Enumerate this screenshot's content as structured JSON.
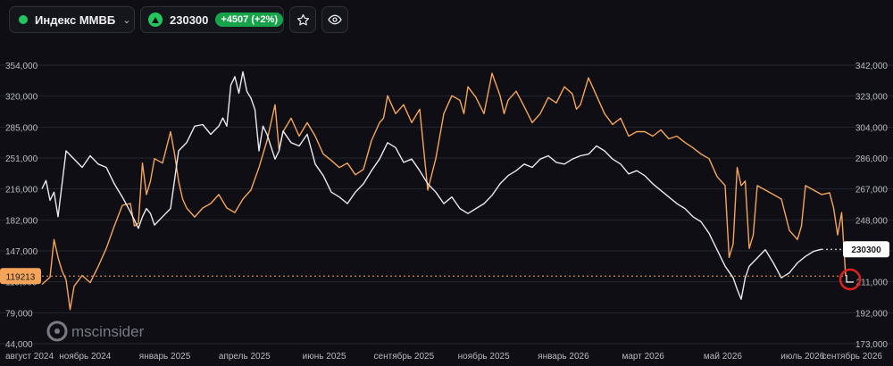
{
  "header": {
    "ticker_name": "Индекс ММВБ",
    "price": "230300",
    "change": "+4507 (+2%)",
    "icons": [
      "dropdown-chevron",
      "up-triangle",
      "star-icon",
      "eye-icon"
    ]
  },
  "watermark": "mscinsider",
  "chart_data": {
    "type": "line",
    "left_axis": {
      "ticks": [
        "354,000",
        "320,000",
        "285,000",
        "251,000",
        "216,000",
        "182,000",
        "147,000",
        "113,000",
        "79,000",
        "44,000"
      ],
      "range": [
        44000,
        354000
      ],
      "current_badge": "119213"
    },
    "right_axis": {
      "ticks": [
        "342,000",
        "323,000",
        "304,000",
        "286,000",
        "267,000",
        "248,000",
        "230,000",
        "211,000",
        "192,000",
        "173,000"
      ],
      "range": [
        173000,
        342000
      ],
      "current_badge": "230300"
    },
    "x_labels": [
      "август 2024",
      "ноябрь 2024",
      "январь 2025",
      "апрель 2025",
      "июнь 2025",
      "сентябрь 2025",
      "ноябрь 2025",
      "январь 2026",
      "март 2026",
      "май 2026",
      "июль 2026",
      "сентябрь 2026"
    ],
    "grid": "horizontal",
    "colors": {
      "orange": "#f5a55a",
      "white": "#e8e8ee",
      "grid": "#262630",
      "badge_orange": "#f5a55a",
      "badge_white": "#ffffff",
      "marker": "#e02020"
    },
    "series": [
      {
        "axis": "left",
        "color": "#f5a55a",
        "points": [
          [
            0,
            110000
          ],
          [
            0.01,
            118000
          ],
          [
            0.015,
            160000
          ],
          [
            0.02,
            140000
          ],
          [
            0.025,
            125000
          ],
          [
            0.03,
            115000
          ],
          [
            0.035,
            82000
          ],
          [
            0.04,
            108000
          ],
          [
            0.05,
            120000
          ],
          [
            0.06,
            112000
          ],
          [
            0.07,
            130000
          ],
          [
            0.08,
            150000
          ],
          [
            0.09,
            175000
          ],
          [
            0.1,
            198000
          ],
          [
            0.11,
            200000
          ],
          [
            0.115,
            175000
          ],
          [
            0.12,
            178000
          ],
          [
            0.125,
            245000
          ],
          [
            0.13,
            210000
          ],
          [
            0.135,
            225000
          ],
          [
            0.14,
            250000
          ],
          [
            0.15,
            245000
          ],
          [
            0.16,
            280000
          ],
          [
            0.165,
            255000
          ],
          [
            0.17,
            225000
          ],
          [
            0.175,
            205000
          ],
          [
            0.18,
            195000
          ],
          [
            0.19,
            185000
          ],
          [
            0.2,
            195000
          ],
          [
            0.21,
            200000
          ],
          [
            0.22,
            210000
          ],
          [
            0.23,
            195000
          ],
          [
            0.24,
            190000
          ],
          [
            0.25,
            205000
          ],
          [
            0.255,
            210000
          ],
          [
            0.26,
            215000
          ],
          [
            0.27,
            240000
          ],
          [
            0.28,
            270000
          ],
          [
            0.29,
            310000
          ],
          [
            0.295,
            260000
          ],
          [
            0.3,
            280000
          ],
          [
            0.31,
            295000
          ],
          [
            0.32,
            275000
          ],
          [
            0.33,
            290000
          ],
          [
            0.34,
            275000
          ],
          [
            0.35,
            255000
          ],
          [
            0.36,
            248000
          ],
          [
            0.37,
            240000
          ],
          [
            0.38,
            245000
          ],
          [
            0.39,
            232000
          ],
          [
            0.4,
            238000
          ],
          [
            0.41,
            270000
          ],
          [
            0.42,
            290000
          ],
          [
            0.425,
            295000
          ],
          [
            0.43,
            320000
          ],
          [
            0.44,
            300000
          ],
          [
            0.45,
            310000
          ],
          [
            0.46,
            290000
          ],
          [
            0.47,
            305000
          ],
          [
            0.48,
            215000
          ],
          [
            0.49,
            250000
          ],
          [
            0.5,
            300000
          ],
          [
            0.51,
            320000
          ],
          [
            0.52,
            315000
          ],
          [
            0.525,
            300000
          ],
          [
            0.53,
            330000
          ],
          [
            0.54,
            318000
          ],
          [
            0.55,
            300000
          ],
          [
            0.56,
            345000
          ],
          [
            0.57,
            320000
          ],
          [
            0.575,
            300000
          ],
          [
            0.58,
            315000
          ],
          [
            0.59,
            325000
          ],
          [
            0.6,
            308000
          ],
          [
            0.61,
            290000
          ],
          [
            0.62,
            300000
          ],
          [
            0.63,
            318000
          ],
          [
            0.64,
            312000
          ],
          [
            0.65,
            330000
          ],
          [
            0.66,
            322000
          ],
          [
            0.665,
            305000
          ],
          [
            0.67,
            310000
          ],
          [
            0.68,
            340000
          ],
          [
            0.69,
            320000
          ],
          [
            0.7,
            300000
          ],
          [
            0.71,
            288000
          ],
          [
            0.72,
            295000
          ],
          [
            0.73,
            275000
          ],
          [
            0.74,
            280000
          ],
          [
            0.75,
            280000
          ],
          [
            0.76,
            275000
          ],
          [
            0.77,
            282000
          ],
          [
            0.78,
            272000
          ],
          [
            0.79,
            275000
          ],
          [
            0.8,
            268000
          ],
          [
            0.81,
            262000
          ],
          [
            0.82,
            255000
          ],
          [
            0.83,
            250000
          ],
          [
            0.84,
            230000
          ],
          [
            0.85,
            220000
          ],
          [
            0.855,
            140000
          ],
          [
            0.86,
            155000
          ],
          [
            0.865,
            240000
          ],
          [
            0.87,
            220000
          ],
          [
            0.875,
            225000
          ],
          [
            0.88,
            150000
          ],
          [
            0.885,
            165000
          ],
          [
            0.89,
            220000
          ],
          [
            0.9,
            215000
          ],
          [
            0.91,
            210000
          ],
          [
            0.92,
            205000
          ],
          [
            0.93,
            170000
          ],
          [
            0.935,
            165000
          ],
          [
            0.94,
            160000
          ],
          [
            0.945,
            175000
          ],
          [
            0.95,
            220000
          ],
          [
            0.96,
            215000
          ],
          [
            0.97,
            210000
          ],
          [
            0.98,
            212000
          ],
          [
            0.985,
            195000
          ],
          [
            0.99,
            165000
          ],
          [
            0.995,
            190000
          ],
          [
            1.0,
            119213
          ]
        ]
      },
      {
        "axis": "right",
        "color": "#e8e8ee",
        "points": [
          [
            0,
            267000
          ],
          [
            0.005,
            272000
          ],
          [
            0.01,
            260000
          ],
          [
            0.015,
            265000
          ],
          [
            0.02,
            250000
          ],
          [
            0.03,
            290000
          ],
          [
            0.04,
            285000
          ],
          [
            0.05,
            280000
          ],
          [
            0.06,
            287000
          ],
          [
            0.07,
            282000
          ],
          [
            0.08,
            280000
          ],
          [
            0.09,
            270000
          ],
          [
            0.1,
            262000
          ],
          [
            0.11,
            253000
          ],
          [
            0.12,
            243000
          ],
          [
            0.125,
            250000
          ],
          [
            0.13,
            255000
          ],
          [
            0.135,
            252000
          ],
          [
            0.14,
            245000
          ],
          [
            0.15,
            250000
          ],
          [
            0.16,
            255000
          ],
          [
            0.17,
            290000
          ],
          [
            0.18,
            295000
          ],
          [
            0.19,
            305000
          ],
          [
            0.2,
            306000
          ],
          [
            0.21,
            300000
          ],
          [
            0.22,
            305000
          ],
          [
            0.225,
            310000
          ],
          [
            0.23,
            305000
          ],
          [
            0.235,
            330000
          ],
          [
            0.24,
            335000
          ],
          [
            0.245,
            325000
          ],
          [
            0.25,
            338000
          ],
          [
            0.255,
            326000
          ],
          [
            0.26,
            322000
          ],
          [
            0.265,
            315000
          ],
          [
            0.27,
            290000
          ],
          [
            0.275,
            305000
          ],
          [
            0.28,
            300000
          ],
          [
            0.29,
            285000
          ],
          [
            0.295,
            290000
          ],
          [
            0.3,
            302000
          ],
          [
            0.31,
            295000
          ],
          [
            0.32,
            293000
          ],
          [
            0.33,
            300000
          ],
          [
            0.34,
            282000
          ],
          [
            0.35,
            275000
          ],
          [
            0.36,
            265000
          ],
          [
            0.37,
            262000
          ],
          [
            0.38,
            258000
          ],
          [
            0.39,
            265000
          ],
          [
            0.4,
            270000
          ],
          [
            0.41,
            278000
          ],
          [
            0.42,
            285000
          ],
          [
            0.43,
            295000
          ],
          [
            0.44,
            292000
          ],
          [
            0.45,
            283000
          ],
          [
            0.46,
            285000
          ],
          [
            0.47,
            278000
          ],
          [
            0.48,
            270000
          ],
          [
            0.49,
            265000
          ],
          [
            0.5,
            258000
          ],
          [
            0.51,
            262000
          ],
          [
            0.52,
            255000
          ],
          [
            0.53,
            252000
          ],
          [
            0.54,
            255000
          ],
          [
            0.55,
            258000
          ],
          [
            0.56,
            263000
          ],
          [
            0.57,
            270000
          ],
          [
            0.58,
            275000
          ],
          [
            0.59,
            278000
          ],
          [
            0.6,
            282000
          ],
          [
            0.61,
            280000
          ],
          [
            0.62,
            285000
          ],
          [
            0.63,
            287000
          ],
          [
            0.64,
            283000
          ],
          [
            0.65,
            282000
          ],
          [
            0.66,
            285000
          ],
          [
            0.67,
            287000
          ],
          [
            0.68,
            288000
          ],
          [
            0.69,
            293000
          ],
          [
            0.7,
            290000
          ],
          [
            0.71,
            285000
          ],
          [
            0.72,
            282000
          ],
          [
            0.73,
            276000
          ],
          [
            0.74,
            278000
          ],
          [
            0.75,
            275000
          ],
          [
            0.76,
            270000
          ],
          [
            0.77,
            266000
          ],
          [
            0.78,
            262000
          ],
          [
            0.79,
            258000
          ],
          [
            0.8,
            255000
          ],
          [
            0.81,
            250000
          ],
          [
            0.82,
            247000
          ],
          [
            0.83,
            240000
          ],
          [
            0.84,
            230000
          ],
          [
            0.85,
            220000
          ],
          [
            0.86,
            213000
          ],
          [
            0.865,
            206000
          ],
          [
            0.87,
            200000
          ],
          [
            0.875,
            213000
          ],
          [
            0.88,
            220000
          ],
          [
            0.89,
            225000
          ],
          [
            0.9,
            230000
          ],
          [
            0.91,
            222000
          ],
          [
            0.92,
            213000
          ],
          [
            0.93,
            216000
          ],
          [
            0.94,
            222000
          ],
          [
            0.95,
            226000
          ],
          [
            0.96,
            229000
          ],
          [
            0.97,
            230300
          ]
        ]
      }
    ]
  }
}
